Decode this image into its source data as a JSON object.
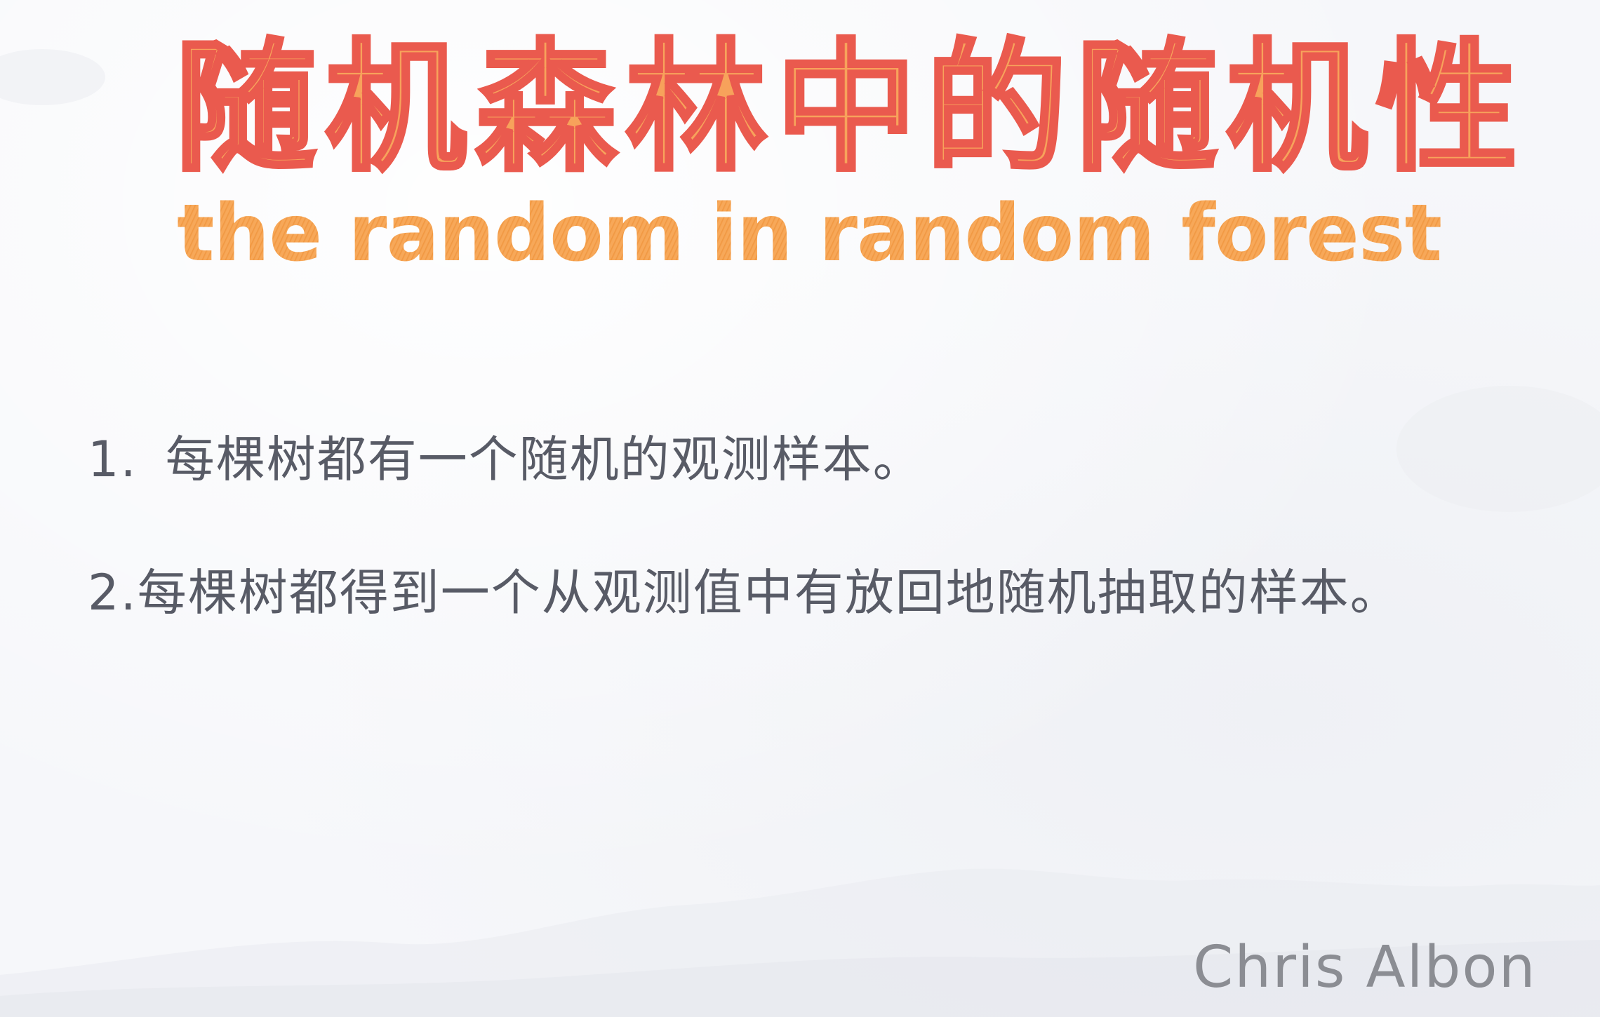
{
  "title": {
    "chinese": "随机森林中的随机性",
    "english": "the random in random forest"
  },
  "items": [
    {
      "number": "1.",
      "text": "每棵树都有一个随机的观测样本。"
    },
    {
      "number": "2.",
      "text": "每棵树都得到一个从观测值中有放回地随机抽取的样本。"
    }
  ],
  "signature": "Chris Albon",
  "colors": {
    "title_fill": "#f7a25b",
    "title_outline": "#ea5a4e",
    "subtitle": "#f5a253",
    "body_text": "#585b66",
    "signature": "#8b8d93",
    "background": "#f6f7fa"
  }
}
